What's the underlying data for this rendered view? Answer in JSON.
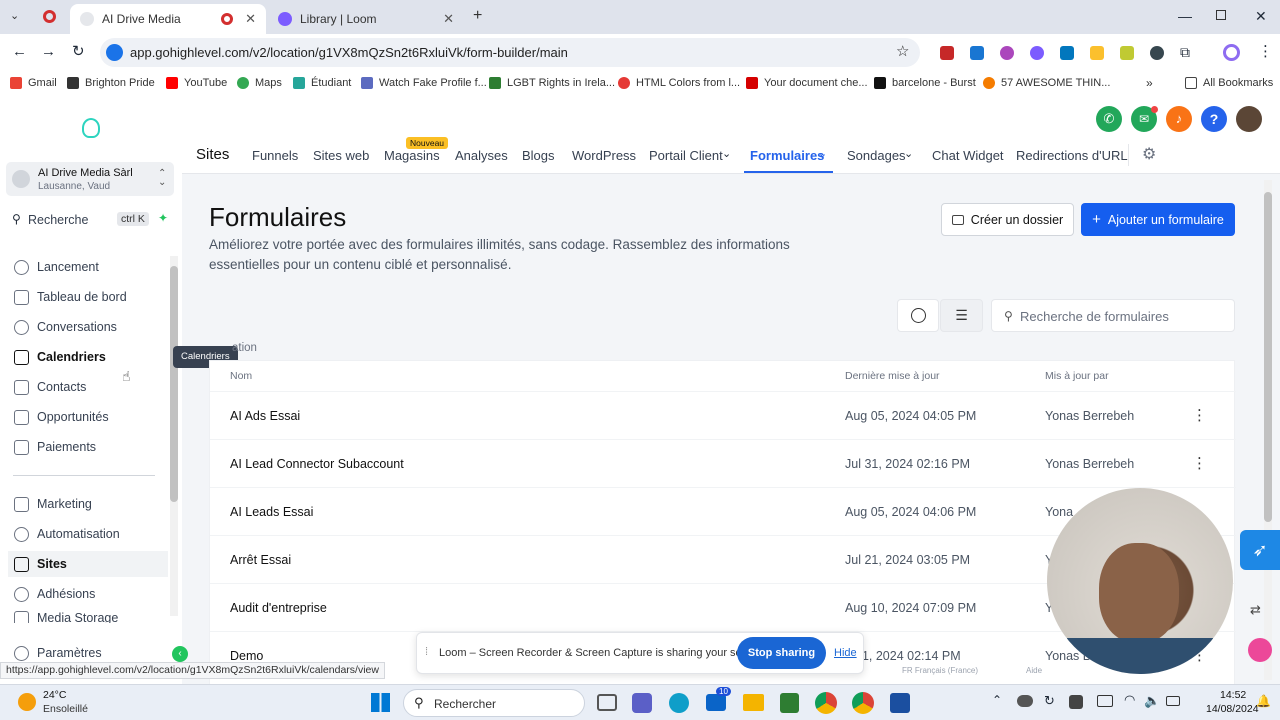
{
  "browser": {
    "tabs": [
      {
        "title": "AI Drive Media",
        "active": true
      },
      {
        "title": "Library | Loom",
        "active": false
      }
    ],
    "url": "app.gohighlevel.com/v2/location/g1VX8mQzSn2t6RxluiVk/form-builder/main",
    "bookmarks": [
      "Gmail",
      "Brighton Pride",
      "YouTube",
      "Maps",
      "Étudiant",
      "Watch Fake Profile f...",
      "LGBT Rights in Irela...",
      "HTML Colors from l...",
      "Your document che...",
      "barcelone - Burst",
      "57 AWESOME THIN...",
      "All Bookmarks"
    ],
    "status_url": "https://app.gohighlevel.com/v2/location/g1VX8mQzSn2t6RxluiVk/calendars/view"
  },
  "sidebar": {
    "account_name": "AI Drive Media Sàrl",
    "account_location": "Lausanne, Vaud",
    "search_label": "Recherche",
    "search_shortcut": "ctrl K",
    "items": [
      "Lancement",
      "Tableau de bord",
      "Conversations",
      "Calendriers",
      "Contacts",
      "Opportunités",
      "Paiements",
      "Marketing",
      "Automatisation",
      "Sites",
      "Adhésions",
      "Media Storage",
      "Paramètres"
    ],
    "tooltip": "Calendriers"
  },
  "topnav": {
    "section": "Sites",
    "tabs": [
      "Funnels",
      "Sites web",
      "Magasins",
      "Analyses",
      "Blogs",
      "WordPress",
      "Portail Client",
      "Formulaires",
      "Sondages",
      "Chat Widget",
      "Redirections d'URL"
    ],
    "new_badge": "Nouveau"
  },
  "page": {
    "title": "Formulaires",
    "subtitle_line1": "Améliorez votre portée avec des formulaires illimités, sans codage. Rassemblez des informations",
    "subtitle_line2": "essentielles pour un contenu ciblé et personnalisé.",
    "create_folder": "Créer un dossier",
    "add_form": "Ajouter un formulaire",
    "search_placeholder": "Recherche de formulaires",
    "partial_label": "ation"
  },
  "table": {
    "headers": {
      "name": "Nom",
      "updated": "Dernière mise à jour",
      "updated_by": "Mis à jour par"
    },
    "rows": [
      {
        "name": "AI Ads Essai",
        "updated": "Aug 05, 2024 04:05 PM",
        "by": "Yonas Berrebeh"
      },
      {
        "name": "AI Lead Connector Subaccount",
        "updated": "Jul 31, 2024 02:16 PM",
        "by": "Yonas Berrebeh"
      },
      {
        "name": "AI Leads Essai",
        "updated": "Aug 05, 2024 04:06 PM",
        "by": "Yona"
      },
      {
        "name": "Arrêt Essai",
        "updated": "Jul 21, 2024 03:05 PM",
        "by": "Y"
      },
      {
        "name": "Audit d'entreprise",
        "updated": "Aug 10, 2024 07:09 PM",
        "by": "Yo"
      },
      {
        "name": "Demo",
        "updated": "31, 2024 02:14 PM",
        "by": "Yonas Be"
      }
    ]
  },
  "loom": {
    "message": "Loom – Screen Recorder & Screen Capture is sharing your screen.",
    "stop": "Stop sharing",
    "hide": "Hide",
    "lang": "FR Français (France)",
    "help": "Aide"
  },
  "taskbar": {
    "temp": "24°C",
    "weather": "Ensoleillé",
    "search": "Rechercher",
    "time": "14:52",
    "date": "14/08/2024",
    "badge": "10"
  },
  "colors": {
    "accent": "#2563eb",
    "primary_button": "#155eef",
    "tabbar": "#dfe3ec"
  }
}
